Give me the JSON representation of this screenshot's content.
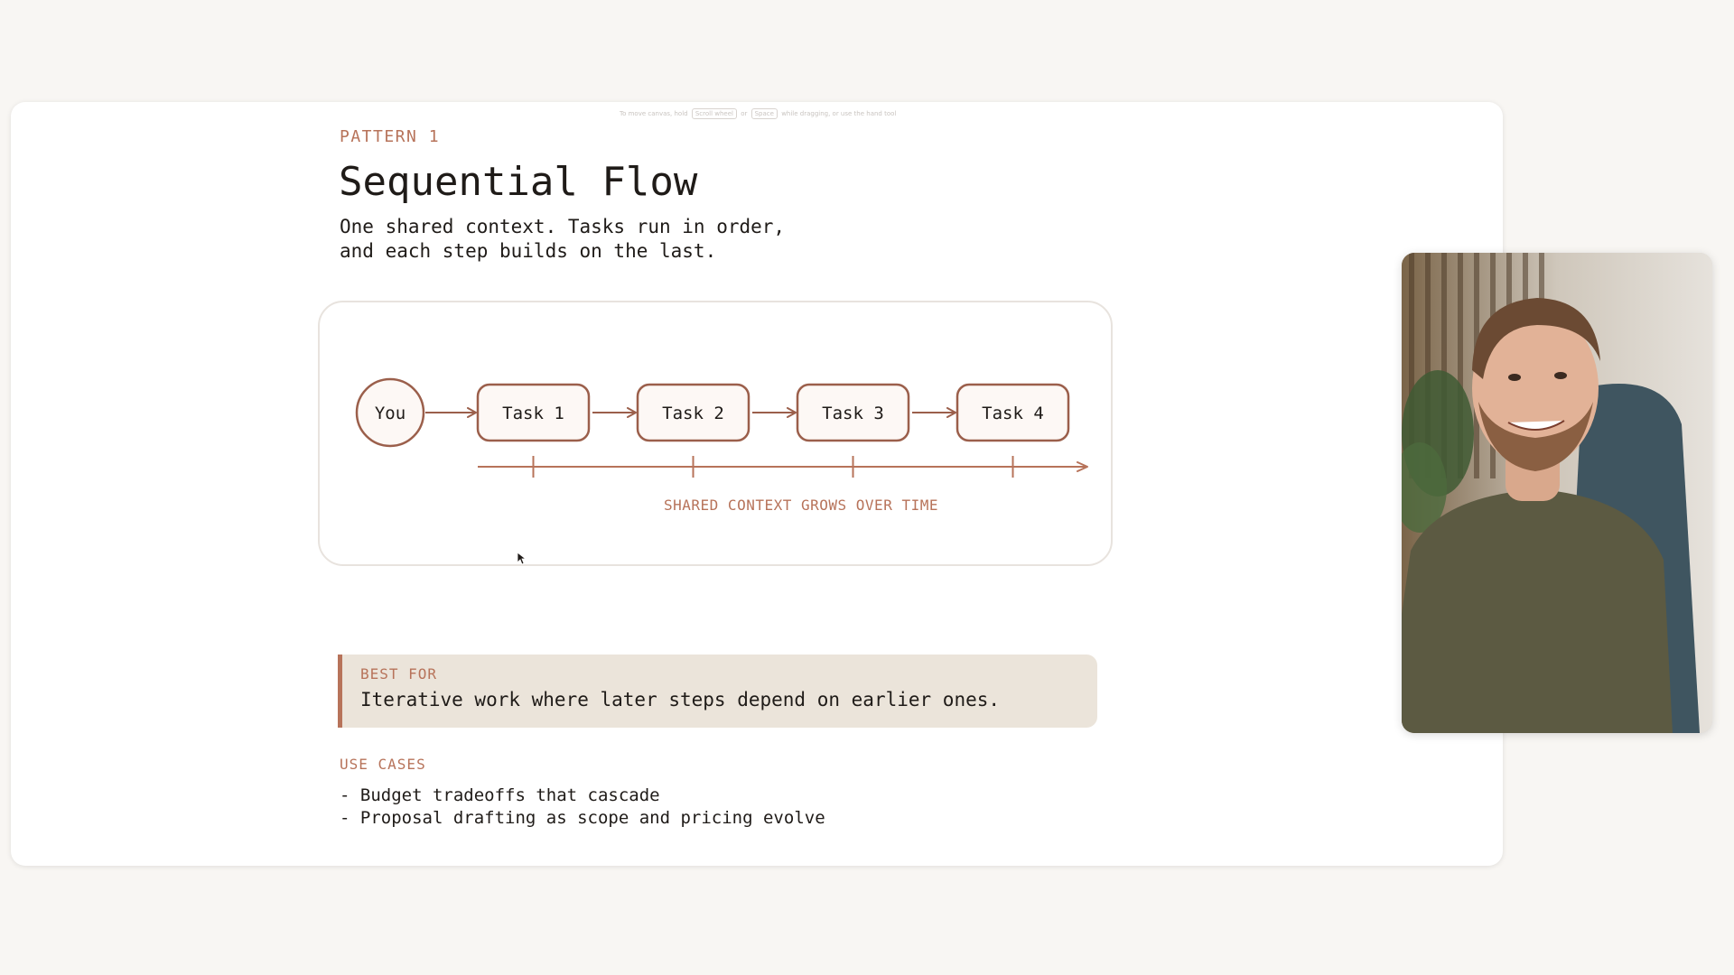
{
  "canvas": {
    "hint_prefix": "To move canvas, hold",
    "hint_key1": "Scroll wheel",
    "hint_or": "or",
    "hint_key2": "Space",
    "hint_suffix": "while dragging, or use the hand tool"
  },
  "slide": {
    "pattern_label": "PATTERN 1",
    "title": "Sequential Flow",
    "subtitle_line1": "One shared context. Tasks run in order,",
    "subtitle_line2": "and each step builds on the last."
  },
  "diagram": {
    "start_node": "You",
    "tasks": [
      "Task 1",
      "Task 2",
      "Task 3",
      "Task 4"
    ],
    "timeline_label": "SHARED CONTEXT GROWS OVER TIME"
  },
  "best_for": {
    "label": "BEST FOR",
    "text": "Iterative work where later steps depend on earlier ones."
  },
  "use_cases": {
    "label": "USE CASES",
    "items": [
      "- Budget tradeoffs that cascade",
      "- Proposal drafting as scope and pricing evolve"
    ]
  },
  "colors": {
    "accent": "#b7735a",
    "node_stroke": "#9b5f4b",
    "node_fill": "#fdf8f5",
    "text": "#1f1b18",
    "callout_bg": "#ebe4da"
  }
}
